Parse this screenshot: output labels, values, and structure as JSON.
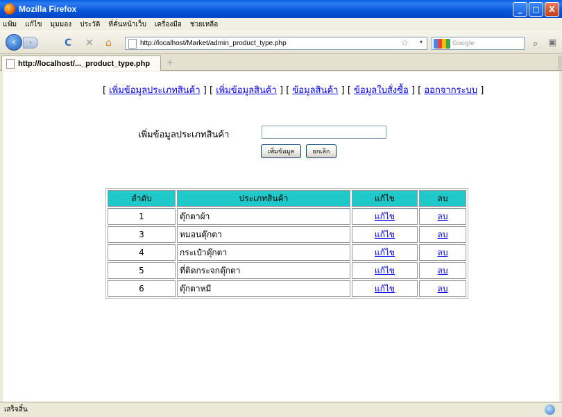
{
  "window": {
    "title": "Mozilla Firefox",
    "minimize": "_",
    "maximize": "□",
    "close": "X"
  },
  "menu": [
    "แฟ้ม",
    "แก้ไข",
    "มุมมอง",
    "ประวัติ",
    "ที่คั่นหน้าเว็บ",
    "เครื่องมือ",
    "ช่วยเหลือ"
  ],
  "nav": {
    "back": "‹",
    "forward": "›",
    "reload": "C",
    "stop": "✕",
    "home": "⌂",
    "url": "http://localhost/Market/admin_product_type.php",
    "star": "☆",
    "dropdown": "▾",
    "search_placeholder": "Google",
    "search_glyph": "⌕",
    "more_glyph": "▣"
  },
  "tab": {
    "title": "http://localhost/..._product_type.php",
    "new_tab": "+"
  },
  "topnav": {
    "open": "[",
    "sep": "] [",
    "close": "]",
    "links": [
      "เพิ่มข้อมูลประเภทสินค้า",
      "เพิ่มข้อมูลสินค้า",
      "ข้อมูลสินค้า",
      "ข้อมูลใบสั่งซื้อ",
      "ออกจากระบบ"
    ]
  },
  "form": {
    "label": "เพิ่มข้อมูลประเภทสินค้า",
    "input_value": "",
    "submit_label": "เพิ่มข้อมูล",
    "cancel_label": "ยกเลิก"
  },
  "table": {
    "headers": [
      "ลำดับ",
      "ประเภทสินค้า",
      "แก้ไข",
      "ลบ"
    ],
    "rows": [
      {
        "id": "1",
        "name": "ตุ๊กตาผ้า",
        "edit": "แก้ไข",
        "delete": "ลบ"
      },
      {
        "id": "3",
        "name": "หมอนตุ๊กตา",
        "edit": "แก้ไข",
        "delete": "ลบ"
      },
      {
        "id": "4",
        "name": "กระเป๋าตุ๊กตา",
        "edit": "แก้ไข",
        "delete": "ลบ"
      },
      {
        "id": "5",
        "name": "ที่ติดกระจกตุ๊กตา",
        "edit": "แก้ไข",
        "delete": "ลบ"
      },
      {
        "id": "6",
        "name": "ตุ๊กตาหมี",
        "edit": "แก้ไข",
        "delete": "ลบ"
      }
    ]
  },
  "status": {
    "text": "เสร็จสิ้น"
  },
  "colors": {
    "header_bg": "#1FC9C9",
    "link": "#0000EE",
    "titlebar": "#0555D8"
  }
}
